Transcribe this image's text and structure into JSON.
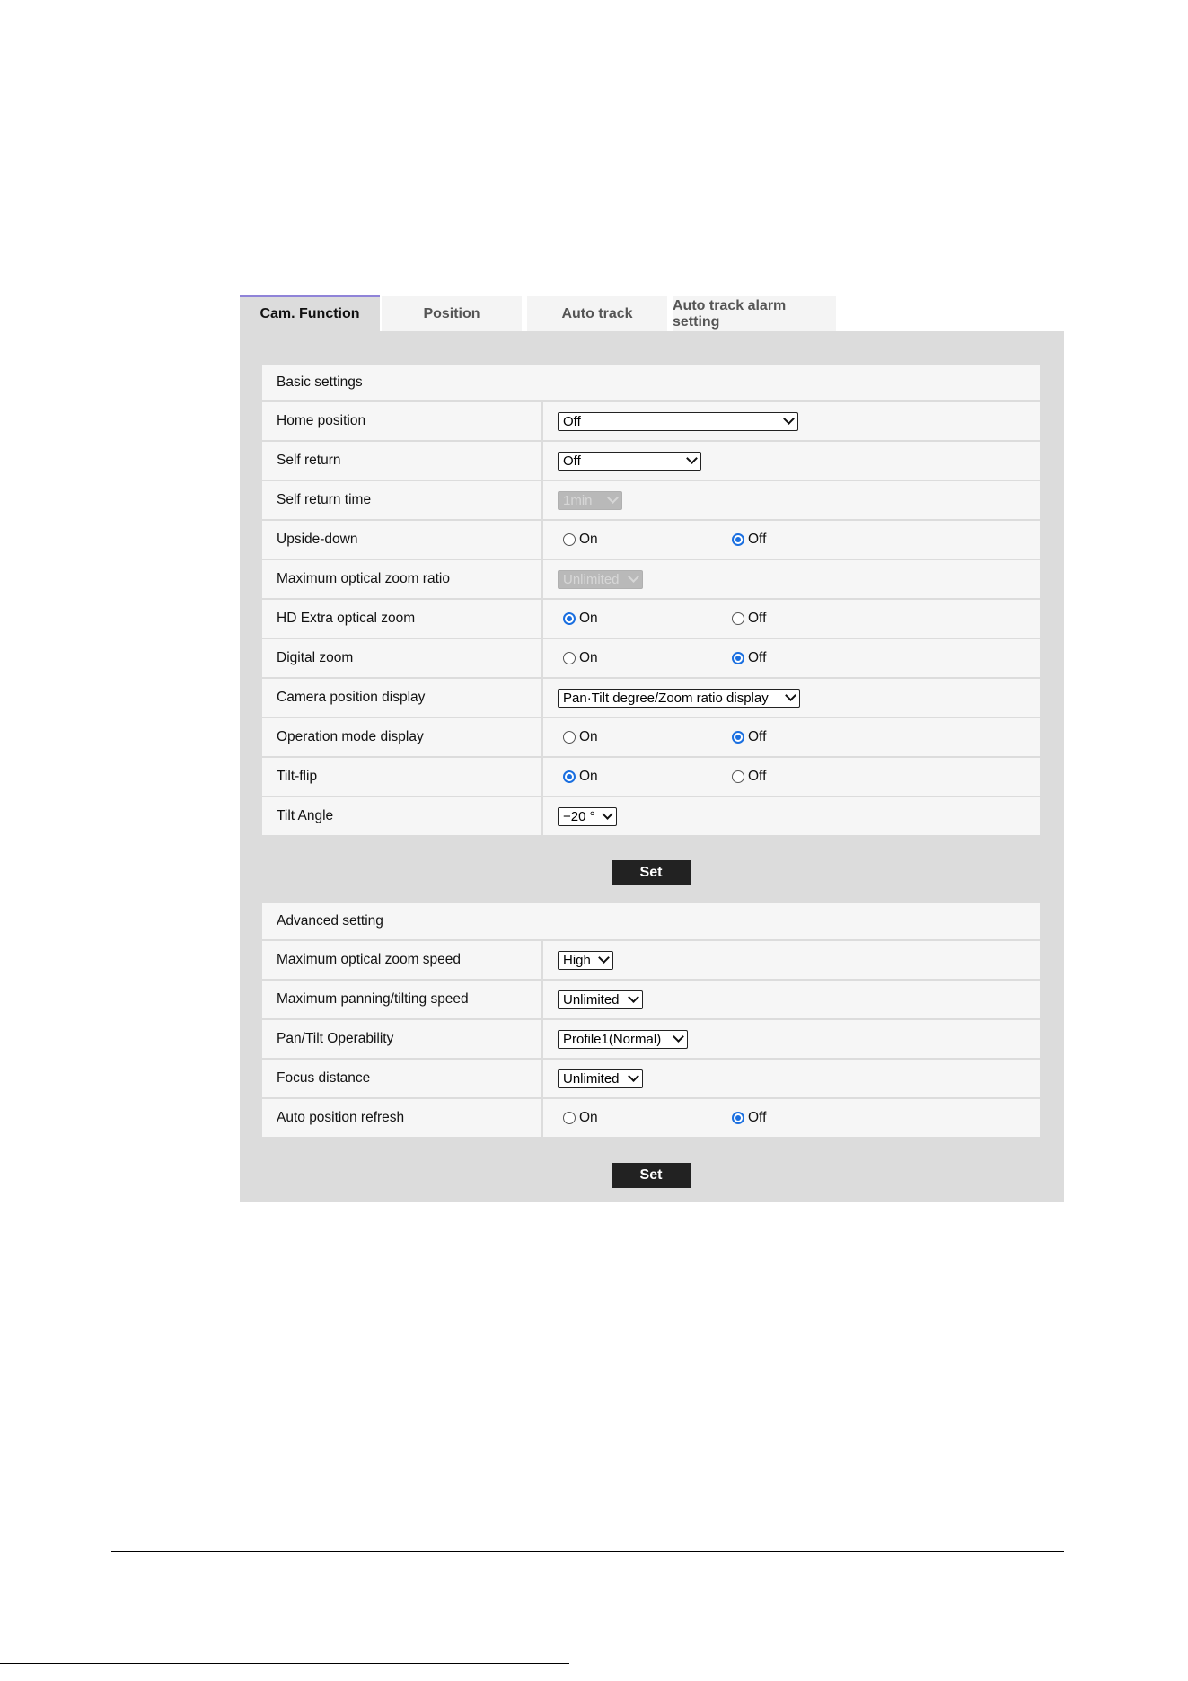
{
  "tabs": [
    {
      "label": "Cam. Function",
      "active": true
    },
    {
      "label": "Position",
      "active": false
    },
    {
      "label": "Auto track",
      "active": false
    },
    {
      "label": "Auto track alarm setting",
      "active": false
    }
  ],
  "basic": {
    "title": "Basic settings",
    "rows": [
      {
        "label": "Home position",
        "type": "select",
        "value": "Off"
      },
      {
        "label": "Self return",
        "type": "select",
        "value": "Off"
      },
      {
        "label": "Self return time",
        "type": "select",
        "value": "1min",
        "disabled": true
      },
      {
        "label": "Upside-down",
        "type": "radio",
        "options": [
          "On",
          "Off"
        ],
        "selected": "Off"
      },
      {
        "label": "Maximum optical zoom ratio",
        "type": "select",
        "value": "Unlimited",
        "disabled": true
      },
      {
        "label": "HD Extra optical zoom",
        "type": "radio",
        "options": [
          "On",
          "Off"
        ],
        "selected": "On"
      },
      {
        "label": "Digital zoom",
        "type": "radio",
        "options": [
          "On",
          "Off"
        ],
        "selected": "Off"
      },
      {
        "label": "Camera position display",
        "type": "select",
        "value": "Pan·Tilt degree/Zoom ratio display"
      },
      {
        "label": "Operation mode display",
        "type": "radio",
        "options": [
          "On",
          "Off"
        ],
        "selected": "Off"
      },
      {
        "label": "Tilt-flip",
        "type": "radio",
        "options": [
          "On",
          "Off"
        ],
        "selected": "On"
      },
      {
        "label": "Tilt Angle",
        "type": "select",
        "value": "−20 °"
      }
    ],
    "set_label": "Set"
  },
  "advanced": {
    "title": "Advanced setting",
    "rows": [
      {
        "label": "Maximum optical zoom speed",
        "type": "select",
        "value": "High"
      },
      {
        "label": "Maximum panning/tilting speed",
        "type": "select",
        "value": "Unlimited"
      },
      {
        "label": "Pan/Tilt Operability",
        "type": "select",
        "value": "Profile1(Normal)"
      },
      {
        "label": "Focus distance",
        "type": "select",
        "value": "Unlimited"
      },
      {
        "label": "Auto position refresh",
        "type": "radio",
        "options": [
          "On",
          "Off"
        ],
        "selected": "Off"
      }
    ],
    "set_label": "Set"
  },
  "colors": {
    "accent": "#8f83d8",
    "radio_selected": "#1a6fe0",
    "panel_bg": "#dcdcdc",
    "button_bg": "#222222"
  }
}
